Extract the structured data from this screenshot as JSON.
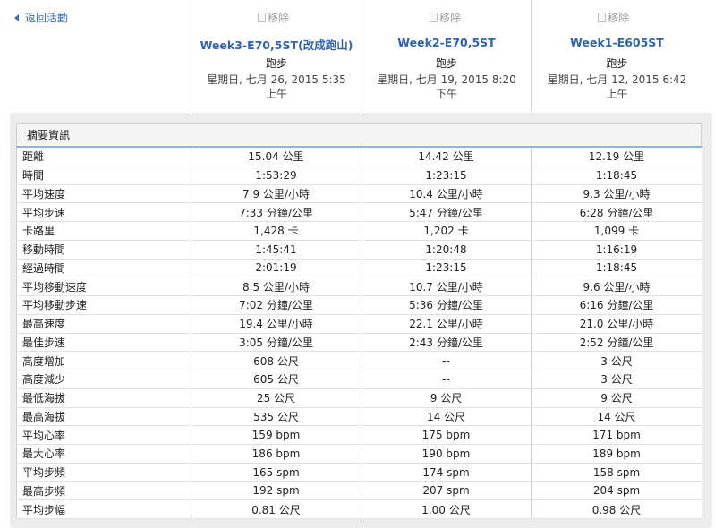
{
  "nav": {
    "back_label": "返回活動"
  },
  "activities": [
    {
      "remove_label": "移除",
      "title": "Week3-E70,5ST(改成跑山)",
      "type": "跑步",
      "date_line1": "星期日, 七月 26, 2015 5:35",
      "date_line2": "上午"
    },
    {
      "remove_label": "移除",
      "title": "Week2-E70,5ST",
      "type": "跑步",
      "date_line1": "星期日, 七月 19, 2015 8:20",
      "date_line2": "下午"
    },
    {
      "remove_label": "移除",
      "title": "Week1-E605ST",
      "type": "跑步",
      "date_line1": "星期日, 七月 12, 2015 6:42",
      "date_line2": "上午"
    }
  ],
  "summary": {
    "title": "摘要資訊",
    "rows": [
      {
        "label": "距離",
        "values": [
          "15.04 公里",
          "14.42 公里",
          "12.19 公里"
        ]
      },
      {
        "label": "時間",
        "values": [
          "1:53:29",
          "1:23:15",
          "1:18:45"
        ]
      },
      {
        "label": "平均速度",
        "values": [
          "7.9 公里/小時",
          "10.4 公里/小時",
          "9.3 公里/小時"
        ]
      },
      {
        "label": "平均步速",
        "values": [
          "7:33 分鐘/公里",
          "5:47 分鐘/公里",
          "6:28 分鐘/公里"
        ]
      },
      {
        "label": "卡路里",
        "values": [
          "1,428 卡",
          "1,202 卡",
          "1,099 卡"
        ]
      },
      {
        "label": "移動時間",
        "values": [
          "1:45:41",
          "1:20:48",
          "1:16:19"
        ]
      },
      {
        "label": "經過時間",
        "values": [
          "2:01:19",
          "1:23:15",
          "1:18:45"
        ]
      },
      {
        "label": "平均移動速度",
        "values": [
          "8.5 公里/小時",
          "10.7 公里/小時",
          "9.6 公里/小時"
        ]
      },
      {
        "label": "平均移動步速",
        "values": [
          "7:02 分鐘/公里",
          "5:36 分鐘/公里",
          "6:16 分鐘/公里"
        ]
      },
      {
        "label": "最高速度",
        "values": [
          "19.4 公里/小時",
          "22.1 公里/小時",
          "21.0 公里/小時"
        ]
      },
      {
        "label": "最佳步速",
        "values": [
          "3:05 分鐘/公里",
          "2:43 分鐘/公里",
          "2:52 分鐘/公里"
        ]
      },
      {
        "label": "高度增加",
        "values": [
          "608 公尺",
          "--",
          "3 公尺"
        ]
      },
      {
        "label": "高度減少",
        "values": [
          "605 公尺",
          "--",
          "3 公尺"
        ]
      },
      {
        "label": "最低海拔",
        "values": [
          "25 公尺",
          "9 公尺",
          "9 公尺"
        ]
      },
      {
        "label": "最高海拔",
        "values": [
          "535 公尺",
          "14 公尺",
          "14 公尺"
        ]
      },
      {
        "label": "平均心率",
        "values": [
          "159 bpm",
          "175 bpm",
          "171 bpm"
        ]
      },
      {
        "label": "最大心率",
        "values": [
          "186 bpm",
          "190 bpm",
          "189 bpm"
        ]
      },
      {
        "label": "平均步頻",
        "values": [
          "165 spm",
          "174 spm",
          "158 spm"
        ]
      },
      {
        "label": "最高步頻",
        "values": [
          "192 spm",
          "207 spm",
          "204 spm"
        ]
      },
      {
        "label": "平均步幅",
        "values": [
          "0.81 公尺",
          "1.00 公尺",
          "0.98 公尺"
        ]
      }
    ]
  },
  "colors": {
    "link": "#2f63b0",
    "accent_line": "#8fb6da",
    "panel_bg": "#ececec"
  }
}
